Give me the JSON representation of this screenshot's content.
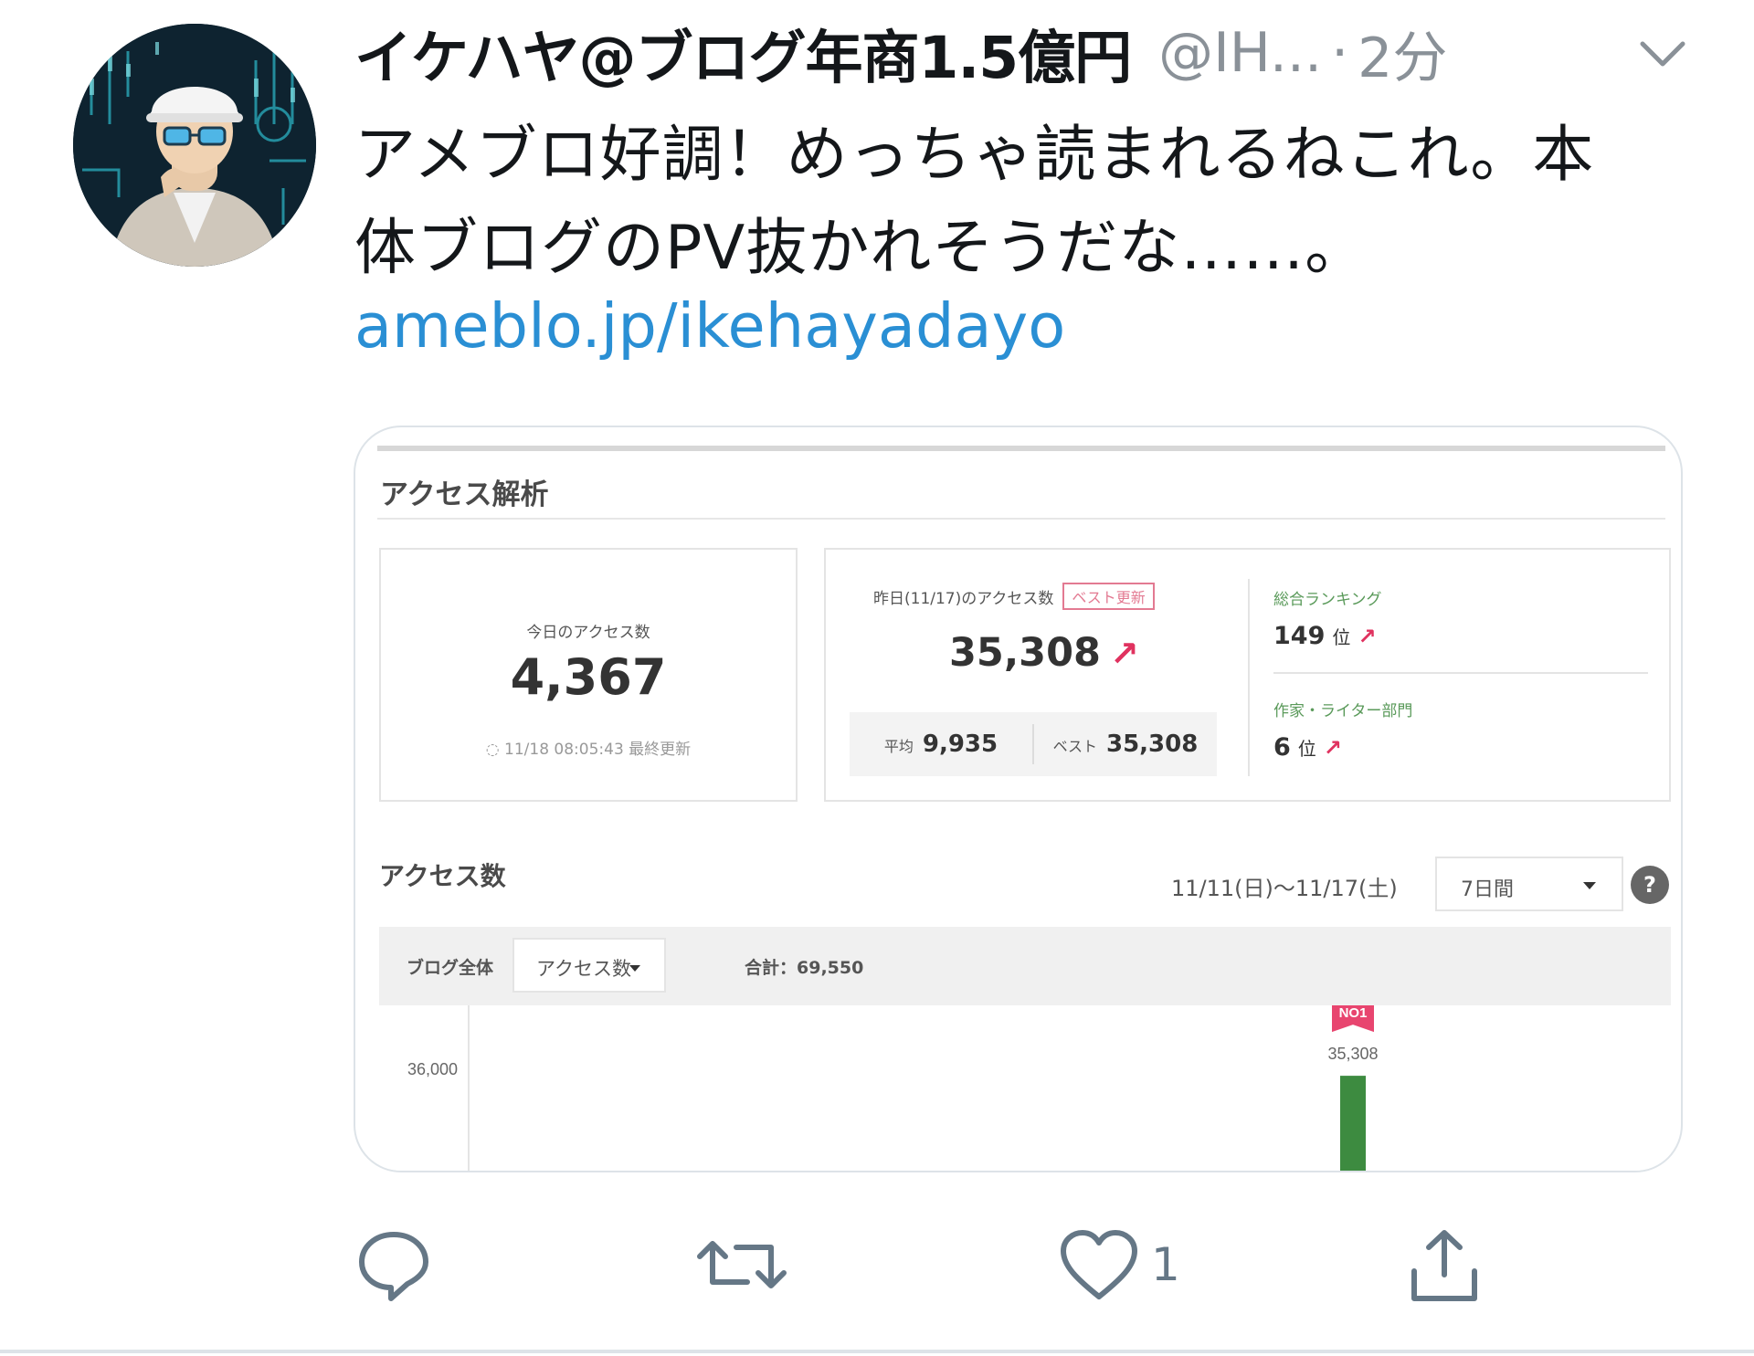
{
  "tweet": {
    "display_name": "イケハヤ@ブログ年商1.5億円",
    "handle": "@IH...",
    "separator": "·",
    "time": "2分",
    "text_lines": [
      "アメブロ好調！めっちゃ読まれるねこれ。本",
      "体ブログのPV抜かれそうだな……。"
    ],
    "link": "ameblo.jp/ikehayadayo"
  },
  "media": {
    "title": "アクセス解析",
    "today": {
      "label": "今日のアクセス数",
      "value": "4,367",
      "updated": "◌ 11/18 08:05:43 最終更新"
    },
    "yesterday": {
      "label": "昨日(11/17)のアクセス数",
      "badge": "ベスト更新",
      "value": "35,308",
      "trend_arrow": "↗",
      "avg_label": "平均",
      "avg_value": "9,935",
      "best_label": "ベスト",
      "best_value": "35,308"
    },
    "ranking": {
      "overall_label": "総合ランキング",
      "overall_value": "149",
      "overall_unit": "位",
      "overall_arrow": "↗",
      "category_label": "作家・ライター部門",
      "category_value": "6",
      "category_unit": "位",
      "category_arrow": "↗"
    },
    "access": {
      "title": "アクセス数",
      "date_range": "11/11(日)〜11/17(土)",
      "period": "7日間",
      "help": "?",
      "scope_label": "ブログ全体",
      "metric_select": "アクセス数",
      "total": "合計：69,550"
    }
  },
  "chart_data": {
    "type": "bar",
    "y_tick_labels": [
      "36,000"
    ],
    "ylim": [
      0,
      36000
    ],
    "visible_bar": {
      "value": 35308,
      "label": "35,308",
      "badge": "NO1",
      "color": "#3d8b40"
    },
    "accent_color": "#e0325f"
  },
  "actions": {
    "reply_icon": "reply-icon",
    "retweet_icon": "retweet-icon",
    "like_icon": "heart-icon",
    "like_count": "1",
    "share_icon": "share-icon"
  },
  "colors": {
    "link": "#2a8fd4",
    "muted": "#8a9198",
    "accent": "#e0325f"
  }
}
